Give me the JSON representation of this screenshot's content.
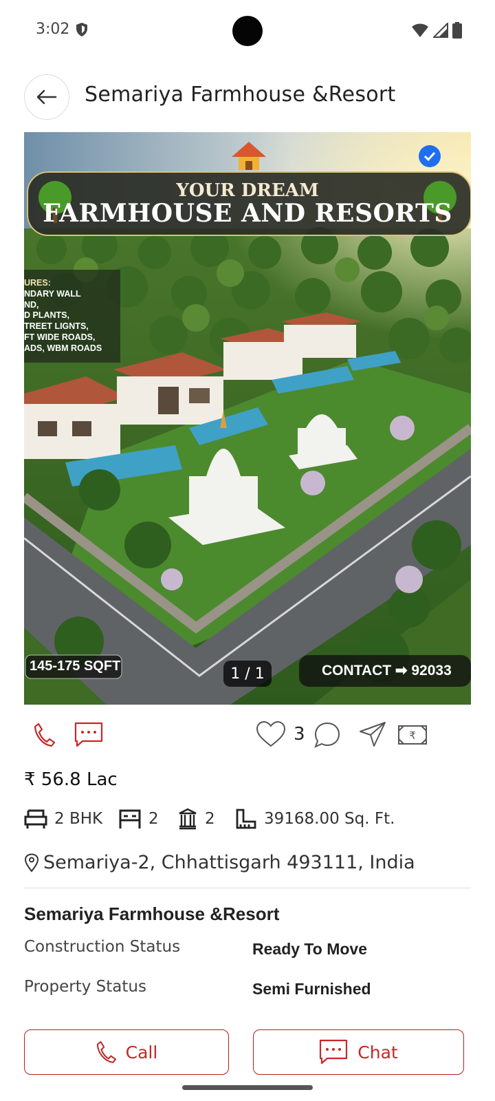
{
  "status_bar": {
    "time": "3:02"
  },
  "header": {
    "title": "Semariya Farmhouse &Resort"
  },
  "hero": {
    "banner_top": "YOUR DREAM",
    "banner_main": "FARMHOUSE AND RESORTS",
    "features_lines": [
      "URES:",
      "NDARY WALL",
      "ND,",
      "D PLANTS,",
      "TREET LIGNTS,",
      "FT WIDE ROADS,",
      "ADS, WBM ROADS"
    ],
    "size_badge": "145-175 SQFT",
    "contact_badge": "CONTACT ➡ 92033",
    "counter": "1 / 1"
  },
  "actions": {
    "likes": "3"
  },
  "price": "₹ 56.8 Lac",
  "features": {
    "bhk": "2 BHK",
    "beds": "2",
    "baths": "2",
    "area": "39168.00 Sq. Ft."
  },
  "location": "Semariya-2, Chhattisgarh 493111, India",
  "details": {
    "title": "Semariya Farmhouse &Resort",
    "rows": [
      {
        "label": "Construction Status",
        "value": "Ready To Move"
      },
      {
        "label": "Property Status",
        "value": "Semi Furnished"
      }
    ]
  },
  "buttons": {
    "call": "Call",
    "chat": "Chat"
  },
  "colors": {
    "accent": "#c62828",
    "verified": "#1e6ff0"
  }
}
